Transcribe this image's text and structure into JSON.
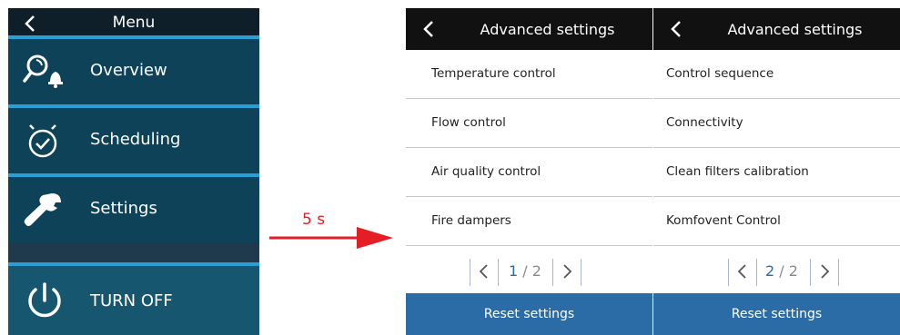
{
  "menu": {
    "title": "Menu",
    "items": [
      {
        "label": "Overview",
        "icon": "overview-alarm-icon"
      },
      {
        "label": "Scheduling",
        "icon": "clock-check-icon"
      },
      {
        "label": "Settings",
        "icon": "wrench-icon"
      },
      {
        "label": "TURN OFF",
        "icon": "power-icon"
      }
    ]
  },
  "transition": {
    "delay_label": "5 s",
    "arrow_color": "#e31e24"
  },
  "panels": [
    {
      "title": "Advanced settings",
      "items": [
        "Temperature control",
        "Flow control",
        "Air quality control",
        "Fire dampers"
      ],
      "pager": {
        "current": "1",
        "total": "2",
        "separator": " / "
      },
      "reset_label": "Reset settings"
    },
    {
      "title": "Advanced settings",
      "items": [
        "Control sequence",
        "Connectivity",
        "Clean filters calibration",
        "Komfovent Control"
      ],
      "pager": {
        "current": "2",
        "total": "2",
        "separator": " / "
      },
      "reset_label": "Reset settings"
    }
  ],
  "colors": {
    "menu_bg": "#0e4258",
    "menu_accent": "#2a9fd6",
    "header_bg": "#111111",
    "button_blue": "#2b6ca6"
  }
}
